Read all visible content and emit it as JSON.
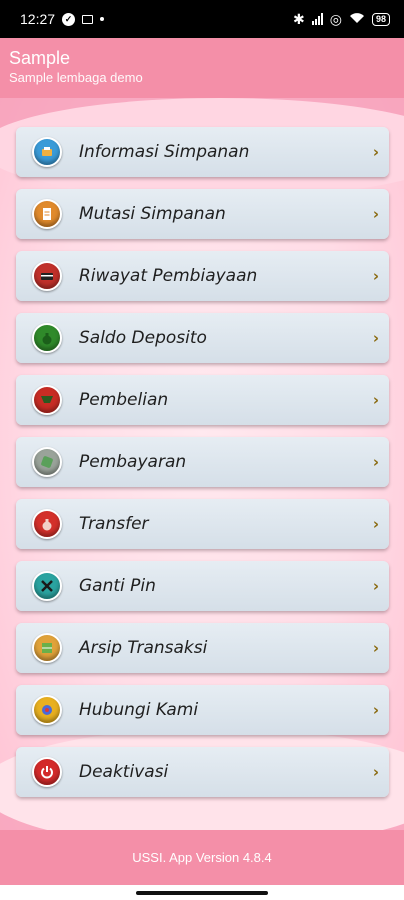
{
  "status_bar": {
    "time": "12:27",
    "battery": "98"
  },
  "header": {
    "title": "Sample",
    "subtitle": "Sample lembaga demo"
  },
  "menu": [
    {
      "label": "Informasi Simpanan",
      "icon": "savings-info-icon",
      "color": "#3a9bd8"
    },
    {
      "label": "Mutasi Simpanan",
      "icon": "document-icon",
      "color": "#e08a2c"
    },
    {
      "label": "Riwayat Pembiayaan",
      "icon": "card-history-icon",
      "color": "#c0302a"
    },
    {
      "label": "Saldo Deposito",
      "icon": "money-bag-icon",
      "color": "#2f8a2a"
    },
    {
      "label": "Pembelian",
      "icon": "cart-icon",
      "color": "#c72c24"
    },
    {
      "label": "Pembayaran",
      "icon": "payment-icon",
      "color": "#8a8a8a"
    },
    {
      "label": "Transfer",
      "icon": "transfer-bag-icon",
      "color": "#d3302a"
    },
    {
      "label": "Ganti Pin",
      "icon": "tools-icon",
      "color": "#2aa3a0"
    },
    {
      "label": "Arsip Transaksi",
      "icon": "archive-icon",
      "color": "#e0a23a"
    },
    {
      "label": "Hubungi Kami",
      "icon": "contact-icon",
      "color": "#e8b020"
    },
    {
      "label": "Deaktivasi",
      "icon": "power-icon",
      "color": "#d32a2a"
    }
  ],
  "chevron": "›",
  "footer": {
    "version_text": "USSI. App Version 4.8.4"
  }
}
